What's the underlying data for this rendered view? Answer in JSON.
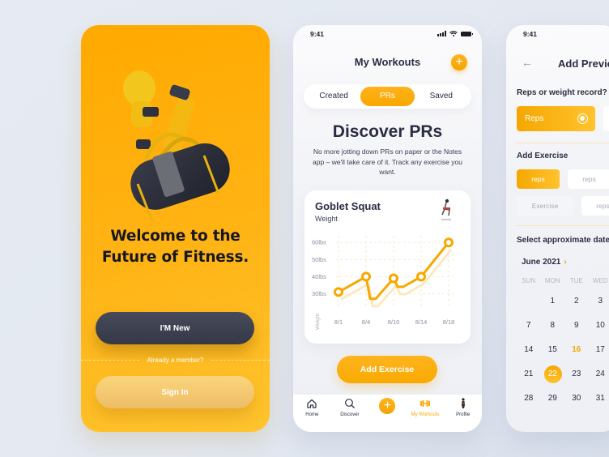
{
  "onboarding": {
    "headline_lines": [
      "Welcome to the",
      "Future of Fitness."
    ],
    "new_button": "I'M New",
    "member_prompt": "Already a member?",
    "signin_button": "Sign In",
    "colors": {
      "brand": "#FFAE0A",
      "dark_button": "#3D404F"
    }
  },
  "workouts": {
    "status_time": "9:41",
    "title": "My Workouts",
    "tabs": [
      {
        "label": "Created",
        "active": false
      },
      {
        "label": "PRs",
        "active": true
      },
      {
        "label": "Saved",
        "active": false
      }
    ],
    "discover_title": "Discover PRs",
    "discover_desc": "No more jotting down PRs on paper or the Notes app – we'll take care of it. Track any exercise you want.",
    "card": {
      "exercise": "Goblet Squat",
      "metric": "Weight"
    },
    "add_exercise_button": "Add Exercise",
    "tabbar": [
      {
        "label": "Home",
        "icon": "home-icon",
        "active": false
      },
      {
        "label": "Discover",
        "icon": "search-icon",
        "active": false
      },
      {
        "label": "",
        "icon": "plus-icon",
        "active": false
      },
      {
        "label": "My Workouts",
        "icon": "dumbbell-icon",
        "active": true
      },
      {
        "label": "Profile",
        "icon": "profile-icon",
        "active": false
      }
    ]
  },
  "chart_data": {
    "type": "line",
    "title": "Goblet Squat",
    "subtitle": "Weight",
    "xlabel": "",
    "ylabel": "Weight",
    "categories": [
      "8/1",
      "8/4",
      "8/10",
      "8/14",
      "8/18"
    ],
    "series": [
      {
        "name": "Weight (lbs)",
        "values": [
          31,
          40,
          39,
          40,
          60
        ]
      }
    ],
    "intermediate_dips": [
      {
        "between": [
          "8/4",
          "8/10"
        ],
        "value": 27
      },
      {
        "between": [
          "8/10",
          "8/14"
        ],
        "value": 34
      }
    ],
    "yticks": [
      "30lbs",
      "40lbs",
      "50lbs",
      "60lbs"
    ],
    "ylim": [
      25,
      62
    ],
    "grid": true,
    "color": "#F7A800"
  },
  "add_previous": {
    "status_time": "9:41",
    "title": "Add Previo",
    "question": "Reps or weight record?",
    "selected_option": "Reps",
    "add_exercise_heading": "Add Exercise",
    "chips_row1": [
      {
        "label": "reps",
        "state": "active"
      },
      {
        "label": "reps",
        "state": "plain"
      }
    ],
    "chips_row2": [
      {
        "label": "Exercise",
        "state": "muted"
      },
      {
        "label": "reps",
        "state": "plain"
      }
    ],
    "date_heading": "Select approximate date",
    "month": "June 2021",
    "weekdays": [
      "SUN",
      "MON",
      "TUE",
      "WED"
    ],
    "weeks": [
      [
        "",
        "1",
        "2",
        "3"
      ],
      [
        "7",
        "8",
        "9",
        "10"
      ],
      [
        "14",
        "15",
        "16",
        "17"
      ],
      [
        "21",
        "22",
        "23",
        "24"
      ],
      [
        "28",
        "29",
        "30",
        "31"
      ]
    ],
    "today": "16",
    "selected_day": "22"
  }
}
